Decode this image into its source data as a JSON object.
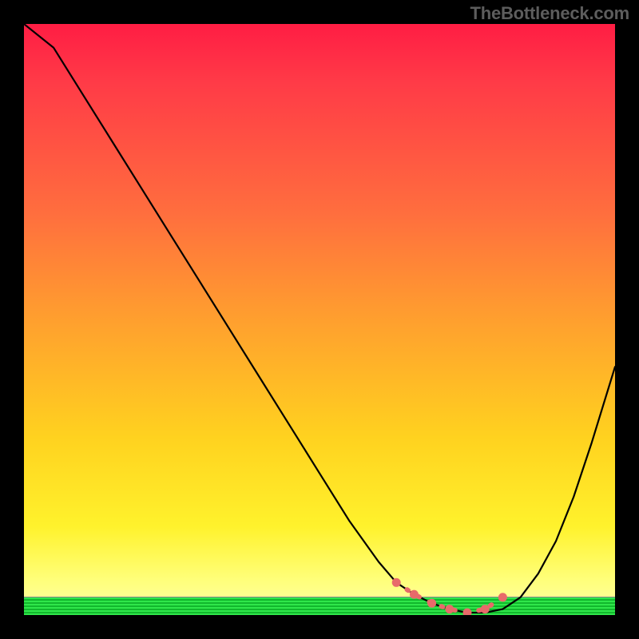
{
  "watermark": "TheBottleneck.com",
  "colors": {
    "background": "#000000",
    "curve": "#000000",
    "marker": "#e86a6a",
    "gradient_top": "#ff1d44",
    "gradient_bottom": "#ffffa8",
    "green_band_light": "#2fe64a",
    "green_band_dark": "#12b82d"
  },
  "chart_data": {
    "type": "line",
    "title": "",
    "xlabel": "",
    "ylabel": "",
    "xlim": [
      0,
      1
    ],
    "ylim": [
      0,
      1
    ],
    "x": [
      0.0,
      0.05,
      0.1,
      0.15,
      0.2,
      0.25,
      0.3,
      0.35,
      0.4,
      0.45,
      0.5,
      0.55,
      0.6,
      0.63,
      0.66,
      0.69,
      0.72,
      0.75,
      0.78,
      0.81,
      0.84,
      0.87,
      0.9,
      0.93,
      0.96,
      1.0
    ],
    "values": [
      1.0,
      0.96,
      0.88,
      0.8,
      0.72,
      0.64,
      0.56,
      0.48,
      0.4,
      0.32,
      0.24,
      0.16,
      0.09,
      0.055,
      0.035,
      0.02,
      0.01,
      0.004,
      0.004,
      0.01,
      0.03,
      0.07,
      0.125,
      0.2,
      0.29,
      0.42
    ],
    "markers": {
      "x": [
        0.63,
        0.66,
        0.69,
        0.72,
        0.75,
        0.78,
        0.81
      ],
      "y": [
        0.055,
        0.035,
        0.02,
        0.01,
        0.004,
        0.01,
        0.03
      ]
    }
  }
}
